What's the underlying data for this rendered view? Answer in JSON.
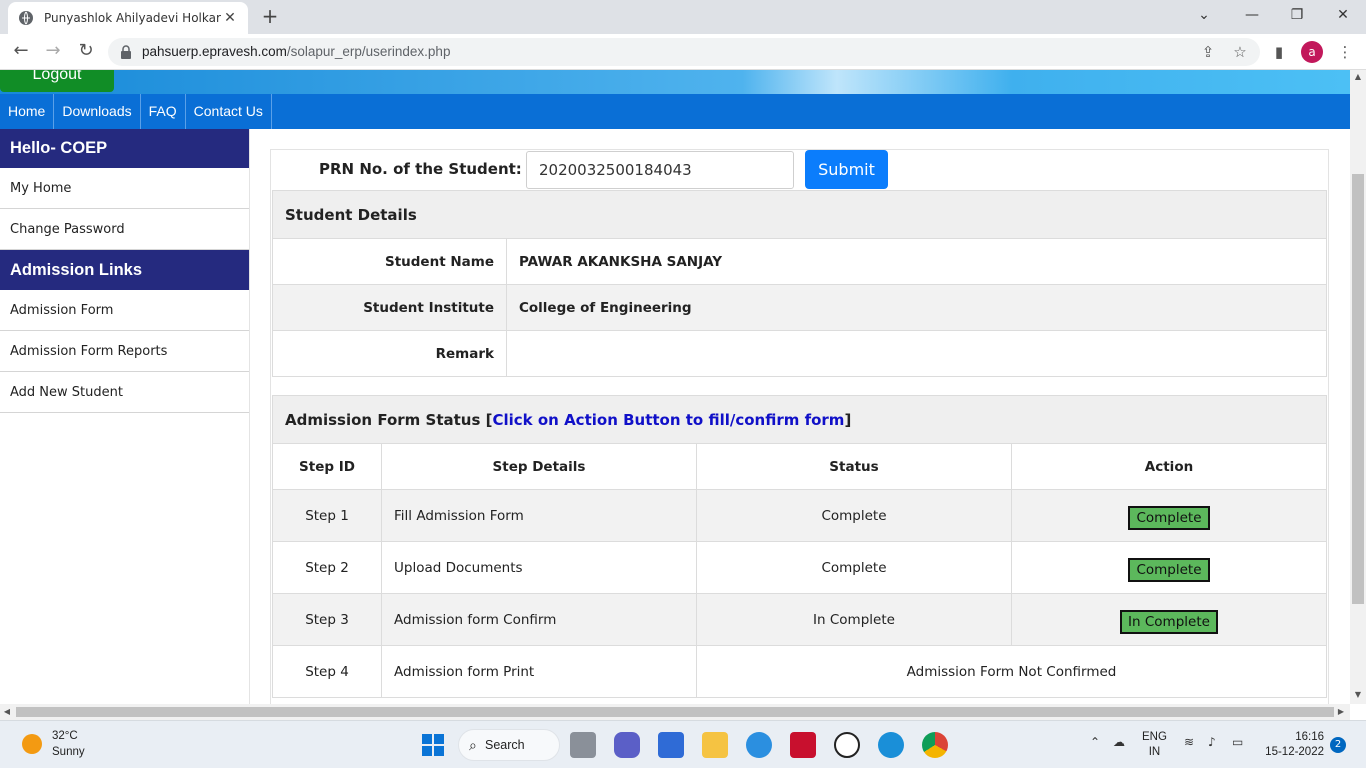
{
  "browser": {
    "tab_title": "Punyashlok Ahilyadevi Holkar So",
    "url_host": "pahsuerp.epravesh.com",
    "url_path": "/solapur_erp/userindex.php",
    "avatar_letter": "a"
  },
  "header": {
    "logout_label": "Logout",
    "nav": [
      "Home",
      "Downloads",
      "FAQ",
      "Contact Us"
    ]
  },
  "sidebar": {
    "greeting": "Hello- COEP",
    "items_top": [
      "My Home",
      "Change Password"
    ],
    "section_title": "Admission Links",
    "items_bottom": [
      "Admission Form",
      "Admission Form Reports",
      "Add New Student"
    ]
  },
  "prn": {
    "label": "PRN No. of the Student:",
    "required_mark": "*",
    "value": "2020032500184043",
    "submit_label": "Submit"
  },
  "student_details": {
    "title": "Student Details",
    "rows": [
      {
        "label": "Student Name",
        "value": "PAWAR AKANKSHA SANJAY"
      },
      {
        "label": "Student Institute",
        "value": "College of Engineering"
      },
      {
        "label": "Remark",
        "value": ""
      }
    ]
  },
  "admission_status": {
    "title": "Admission Form Status",
    "bracket_open": "[",
    "link_text": "Click on Action Button to fill/confirm form",
    "bracket_close": "]",
    "columns": [
      "Step ID",
      "Step Details",
      "Status",
      "Action"
    ],
    "rows": [
      {
        "id": "Step 1",
        "details": "Fill Admission Form",
        "status": "Complete",
        "action": "Complete"
      },
      {
        "id": "Step 2",
        "details": "Upload Documents",
        "status": "Complete",
        "action": "Complete"
      },
      {
        "id": "Step 3",
        "details": "Admission form Confirm",
        "status": "In Complete",
        "action": "In Complete"
      },
      {
        "id": "Step 4",
        "details": "Admission form Print",
        "merged_status": "Admission Form Not Confirmed"
      }
    ]
  },
  "taskbar": {
    "temperature": "32°C",
    "condition": "Sunny",
    "search_label": "Search",
    "lang_top": "ENG",
    "lang_bottom": "IN",
    "time": "16:16",
    "date": "15-12-2022",
    "notification_count": "2"
  },
  "colors": {
    "nav_blue": "#0a6fd6",
    "sidebar_header": "#252a7f",
    "logout_green": "#118d26",
    "submit_blue": "#0b7dfc",
    "action_green": "#5cb85c",
    "link_blue": "#1010c8"
  }
}
